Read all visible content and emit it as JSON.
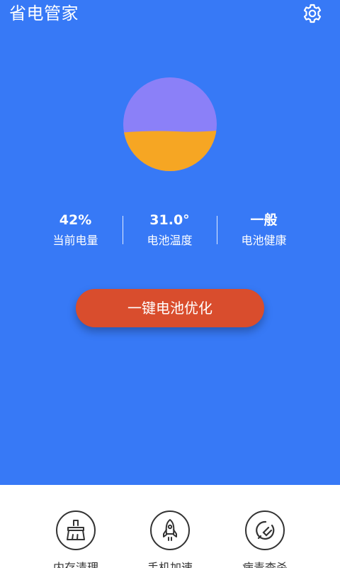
{
  "header": {
    "title": "省电管家",
    "settings_icon": "gear-icon"
  },
  "battery": {
    "level_fraction": 0.42,
    "top_color": "#8b80f8",
    "fill_color": "#f6a623"
  },
  "stats": [
    {
      "value": "42%",
      "label": "当前电量"
    },
    {
      "value": "31.0°",
      "label": "电池温度"
    },
    {
      "value": "一般",
      "label": "电池健康"
    }
  ],
  "action": {
    "label": "一键电池优化",
    "color": "#d94d2d"
  },
  "tools": [
    {
      "label": "内存清理",
      "icon": "broom-icon"
    },
    {
      "label": "手机加速",
      "icon": "rocket-icon"
    },
    {
      "label": "病毒查杀",
      "icon": "virus-scan-icon"
    }
  ],
  "colors": {
    "background": "#3779f6",
    "panel": "#ffffff"
  }
}
